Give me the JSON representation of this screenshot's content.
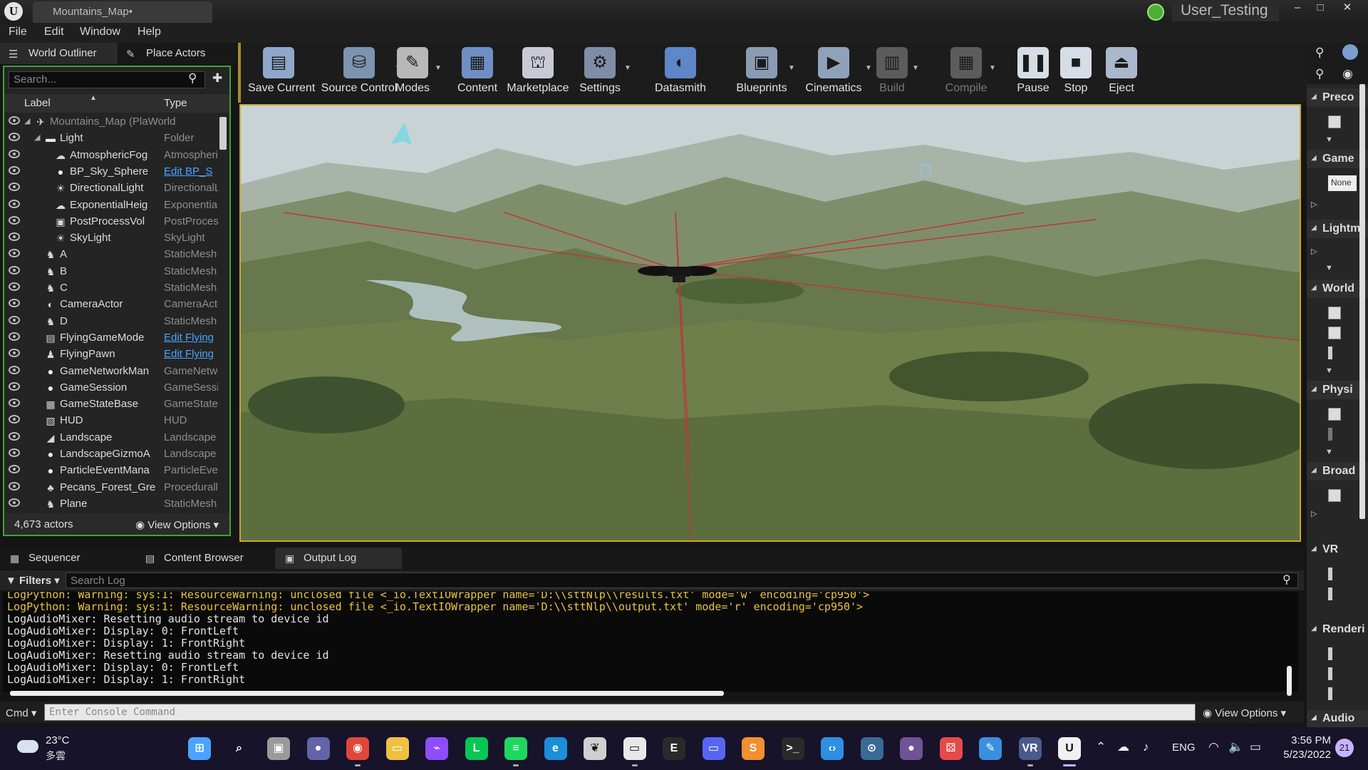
{
  "window": {
    "title": "Mountains_Map•",
    "user": "User_Testing",
    "controls": [
      "–",
      "□",
      "✕"
    ]
  },
  "menu": [
    "File",
    "Edit",
    "Window",
    "Help"
  ],
  "left_tabs": {
    "world_outliner": "World Outliner",
    "place_actors": "Place Actors"
  },
  "outliner": {
    "search_placeholder": "Search...",
    "col_label": "Label",
    "col_type": "Type",
    "rows": [
      {
        "label": "Mountains_Map (PlaWorld",
        "type": "",
        "indent": 0,
        "icon": "world-icon",
        "expander": "◢",
        "dim": true
      },
      {
        "label": "Light",
        "type": "Folder",
        "indent": 1,
        "icon": "folder-icon",
        "expander": "◢"
      },
      {
        "label": "AtmosphericFog",
        "type": "Atmospheri",
        "indent": 2,
        "icon": "fog-icon"
      },
      {
        "label": "BP_Sky_Sphere",
        "type": "Edit BP_S",
        "indent": 2,
        "icon": "sphere-icon",
        "link": true
      },
      {
        "label": "DirectionalLight",
        "type": "DirectionalL",
        "indent": 2,
        "icon": "sun-icon"
      },
      {
        "label": "ExponentialHeig",
        "type": "Exponentia",
        "indent": 2,
        "icon": "fog-icon"
      },
      {
        "label": "PostProcessVol",
        "type": "PostProces",
        "indent": 2,
        "icon": "volume-icon"
      },
      {
        "label": "SkyLight",
        "type": "SkyLight",
        "indent": 2,
        "icon": "skylight-icon"
      },
      {
        "label": "A",
        "type": "StaticMesh",
        "indent": 1,
        "icon": "mesh-icon"
      },
      {
        "label": "B",
        "type": "StaticMesh",
        "indent": 1,
        "icon": "mesh-icon"
      },
      {
        "label": "C",
        "type": "StaticMesh",
        "indent": 1,
        "icon": "mesh-icon"
      },
      {
        "label": "CameraActor",
        "type": "CameraActo",
        "indent": 1,
        "icon": "camera-icon"
      },
      {
        "label": "D",
        "type": "StaticMesh",
        "indent": 1,
        "icon": "mesh-icon"
      },
      {
        "label": "FlyingGameMode",
        "type": "Edit Flying",
        "indent": 1,
        "icon": "gamemode-icon",
        "link": true
      },
      {
        "label": "FlyingPawn",
        "type": "Edit Flying",
        "indent": 1,
        "icon": "pawn-icon",
        "link": true
      },
      {
        "label": "GameNetworkMan",
        "type": "GameNetwo",
        "indent": 1,
        "icon": "sphere-icon"
      },
      {
        "label": "GameSession",
        "type": "GameSessi",
        "indent": 1,
        "icon": "sphere-icon"
      },
      {
        "label": "GameStateBase",
        "type": "GameStateI",
        "indent": 1,
        "icon": "gamestate-icon"
      },
      {
        "label": "HUD",
        "type": "HUD",
        "indent": 1,
        "icon": "hud-icon"
      },
      {
        "label": "Landscape",
        "type": "Landscape",
        "indent": 1,
        "icon": "landscape-icon"
      },
      {
        "label": "LandscapeGizmoA",
        "type": "Landscape",
        "indent": 1,
        "icon": "sphere-icon"
      },
      {
        "label": "ParticleEventMana",
        "type": "ParticleEve",
        "indent": 1,
        "icon": "sphere-icon"
      },
      {
        "label": "Pecans_Forest_Gre",
        "type": "Procedurall",
        "indent": 1,
        "icon": "foliage-icon"
      },
      {
        "label": "Plane",
        "type": "StaticMesh",
        "indent": 1,
        "icon": "mesh-icon"
      }
    ],
    "actor_count": "4,673 actors",
    "view_options": "View Options"
  },
  "toolbar": [
    {
      "label": "Save Current",
      "icon": "save-icon",
      "color": "#8fa7c9"
    },
    {
      "label": "Source Control",
      "icon": "source-control-icon",
      "color": "#7d93b0",
      "drop": true
    },
    {
      "label": "Modes",
      "icon": "modes-icon",
      "color": "#b8b8b8",
      "drop": true
    },
    {
      "label": "Content",
      "icon": "content-icon",
      "color": "#6f8fc4"
    },
    {
      "label": "Marketplace",
      "icon": "marketplace-icon",
      "color": "#c9c9d6"
    },
    {
      "label": "Settings",
      "icon": "settings-icon",
      "color": "#7d8ea6",
      "drop": true
    },
    {
      "label": "Datasmith",
      "icon": "datasmith-icon",
      "color": "#5f86c8"
    },
    {
      "label": "Blueprints",
      "icon": "blueprints-icon",
      "color": "#8a9cb3",
      "drop": true
    },
    {
      "label": "Cinematics",
      "icon": "cinematics-icon",
      "color": "#8fa2ba",
      "drop": true
    },
    {
      "label": "Build",
      "icon": "build-icon",
      "color": "#5c5c5c",
      "drop": true,
      "dim": true
    },
    {
      "label": "Compile",
      "icon": "compile-icon",
      "color": "#5c5c5c",
      "drop": true,
      "dim": true
    },
    {
      "label": "Pause",
      "icon": "pause-icon",
      "color": "#d6dde6"
    },
    {
      "label": "Stop",
      "icon": "stop-icon",
      "color": "#d6dde6"
    },
    {
      "label": "Eject",
      "icon": "eject-icon",
      "color": "#a9b8cc"
    }
  ],
  "viewport": {
    "markers": [
      "A",
      "D"
    ]
  },
  "right_panel": {
    "sections": [
      "Preco",
      "Game",
      "Lightm",
      "World",
      "Physi",
      "Broad",
      "VR",
      "Renderi"
    ],
    "game_mode_value": "None",
    "audio": "Audio"
  },
  "bottom_tabs": [
    "Sequencer",
    "Content Browser",
    "Output Log"
  ],
  "log": {
    "filters": "Filters",
    "search_placeholder": "Search Log",
    "lines": [
      {
        "text": "LogPython: Warning: sys:1: ResourceWarning: unclosed file <_io.TextIOWrapper name='D:\\\\sttNlp\\\\results.txt' mode='w' encoding='cp950'>",
        "level": "warn"
      },
      {
        "text": "LogPython: Warning: sys:1: ResourceWarning: unclosed file <_io.TextIOWrapper name='D:\\\\sttNlp\\\\output.txt' mode='r' encoding='cp950'>",
        "level": "warn"
      },
      {
        "text": "LogAudioMixer: Resetting audio stream to device id",
        "level": "info"
      },
      {
        "text": "LogAudioMixer: Display: 0: FrontLeft",
        "level": "info"
      },
      {
        "text": "LogAudioMixer: Display: 1: FrontRight",
        "level": "info"
      },
      {
        "text": "LogAudioMixer: Resetting audio stream to device id",
        "level": "info"
      },
      {
        "text": "LogAudioMixer: Display: 0: FrontLeft",
        "level": "info"
      },
      {
        "text": "LogAudioMixer: Display: 1: FrontRight",
        "level": "info"
      }
    ],
    "cmd_label": "Cmd",
    "cmd_placeholder": "Enter Console Command",
    "view_options": "View Options"
  },
  "taskbar": {
    "weather_temp": "23°C",
    "weather_desc": "多雲",
    "apps": [
      {
        "name": "windows-start-icon",
        "color": "#4ba3ff",
        "glyph": "⊞"
      },
      {
        "name": "search-icon",
        "color": "#16132a",
        "glyph": "⌕"
      },
      {
        "name": "task-view-icon",
        "color": "#9a9a9a",
        "glyph": "▣"
      },
      {
        "name": "chat-icon",
        "color": "#6264a7",
        "glyph": "●"
      },
      {
        "name": "chrome-icon",
        "color": "#e0463a",
        "glyph": "◉"
      },
      {
        "name": "file-explorer-icon",
        "color": "#f0c043",
        "glyph": "▭"
      },
      {
        "name": "messenger-icon",
        "color": "#8f4dff",
        "glyph": "⌁"
      },
      {
        "name": "line-icon",
        "color": "#06c755",
        "glyph": "L"
      },
      {
        "name": "spotify-icon",
        "color": "#1ed760",
        "glyph": "≡"
      },
      {
        "name": "edge-icon",
        "color": "#1b8fd8",
        "glyph": "e"
      },
      {
        "name": "inkscape-icon",
        "color": "#cfcfcf",
        "glyph": "❦"
      },
      {
        "name": "oculus-icon",
        "color": "#e8e8e8",
        "glyph": "▭"
      },
      {
        "name": "epic-games-icon",
        "color": "#2a2a2a",
        "glyph": "E"
      },
      {
        "name": "discord-like-icon",
        "color": "#5865f2",
        "glyph": "▭"
      },
      {
        "name": "sublime-icon",
        "color": "#f28f30",
        "glyph": "S"
      },
      {
        "name": "terminal-icon",
        "color": "#2a2a2a",
        "glyph": ">_"
      },
      {
        "name": "vscode-icon",
        "color": "#2f8fe0",
        "glyph": "‹›"
      },
      {
        "name": "steam-icon",
        "color": "#3a6a96",
        "glyph": "⊙"
      },
      {
        "name": "github-icon",
        "color": "#6e5494",
        "glyph": "●"
      },
      {
        "name": "dice-icon",
        "color": "#e64a4a",
        "glyph": "⚄"
      },
      {
        "name": "paint-icon",
        "color": "#3a8fe0",
        "glyph": "✎"
      },
      {
        "name": "vr-icon",
        "color": "#4a5a8a",
        "glyph": "VR"
      },
      {
        "name": "unreal-icon",
        "color": "#f0f0f0",
        "glyph": "U"
      }
    ],
    "lang": "ENG",
    "time": "3:56 PM",
    "date": "5/23/2022",
    "notifications": "21"
  }
}
